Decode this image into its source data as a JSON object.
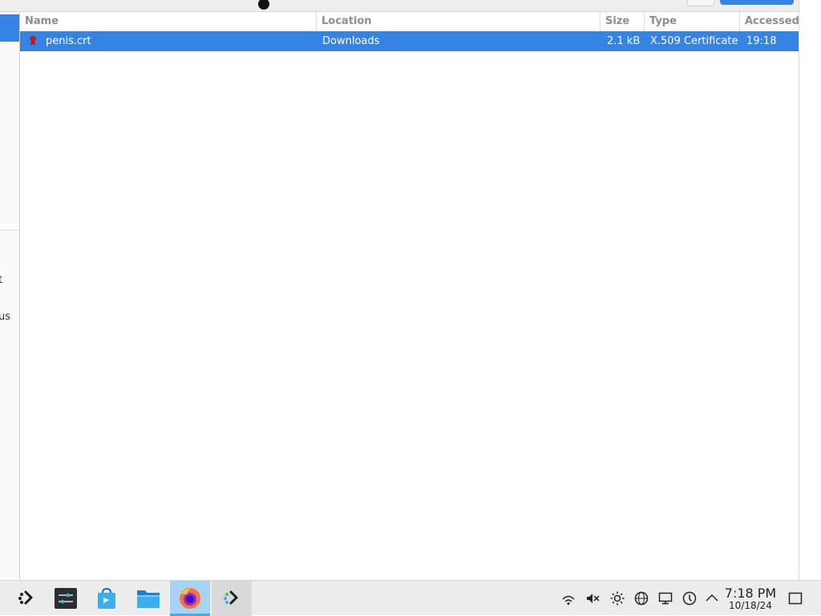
{
  "columns": [
    "Name",
    "Location",
    "Size",
    "Type",
    "Accessed"
  ],
  "files": [
    {
      "name": "penis.crt",
      "location": "Downloads",
      "size": "2.1 kB",
      "type": "X.509 Certificate",
      "accessed": "19:18",
      "icon": "certificate-icon"
    }
  ],
  "sidebar": {
    "partial_items": [
      "t",
      "us"
    ]
  },
  "taskbar": {
    "apps": [
      {
        "name": "app-launcher",
        "icon": "app-launcher-icon"
      },
      {
        "name": "system-settings",
        "icon": "system-settings-icon"
      },
      {
        "name": "discover-store",
        "icon": "store-icon"
      },
      {
        "name": "file-manager",
        "icon": "folder-icon"
      },
      {
        "name": "firefox",
        "icon": "firefox-icon",
        "active": true
      },
      {
        "name": "launcher-2",
        "icon": "app-launcher-icon"
      }
    ],
    "tray": [
      "network-icon",
      "volume-muted-icon",
      "brightness-icon",
      "vpn-globe-icon",
      "display-icon",
      "updates-icon",
      "expand-tray-icon"
    ],
    "clock": {
      "time": "7:18 PM",
      "date": "10/18/24"
    }
  },
  "colors": {
    "accent": "#3584e4",
    "taskbar_active": "#a9d3f2"
  }
}
